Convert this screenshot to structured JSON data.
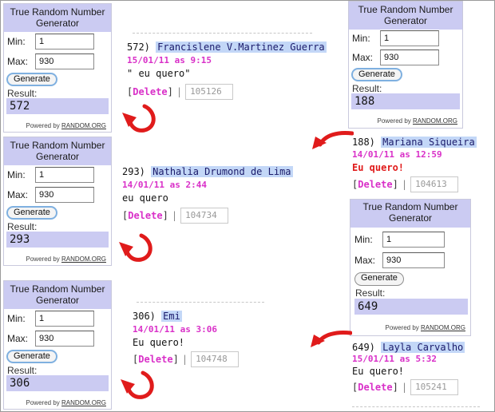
{
  "widget": {
    "title": "True Random Number Generator",
    "min_label": "Min:",
    "max_label": "Max:",
    "min_value": "1",
    "max_value": "930",
    "generate_label": "Generate",
    "result_label": "Result:",
    "powered_prefix": "Powered by",
    "powered_link": "RANDOM.ORG"
  },
  "results": [
    "572",
    "293",
    "306",
    "188",
    "649"
  ],
  "comments": [
    {
      "num": "572)",
      "name": "Francislene V.Martinez Guerra",
      "date": "15/01/11 as 9:15",
      "text": "\" eu quero\"",
      "delete": "Delete",
      "id": "105126"
    },
    {
      "num": "293)",
      "name": "Nathalia Drumond de Lima",
      "date": "14/01/11 as 2:44",
      "text": "eu quero",
      "delete": "Delete",
      "id": "104734"
    },
    {
      "num": "306)",
      "name": "Emi",
      "date": "14/01/11 as 3:06",
      "text": "Eu quero!",
      "delete": "Delete",
      "id": "104748"
    },
    {
      "num": "188)",
      "name": "Mariana Siqueira",
      "date": "14/01/11 as 12:59",
      "text": "Eu quero!",
      "delete": "Delete",
      "id": "104613"
    },
    {
      "num": "649)",
      "name": "Layla Carvalho",
      "date": "15/01/11 as 5:32",
      "text": "Eu quero!",
      "delete": "Delete",
      "id": "105241"
    }
  ],
  "colors": {
    "widget_header": "#cbcbf2",
    "name_highlight": "#c3d7f7",
    "date": "#d930c8",
    "arrow": "#e01b1b"
  },
  "icons": {
    "arrow": "red-curved-arrow-icon"
  }
}
